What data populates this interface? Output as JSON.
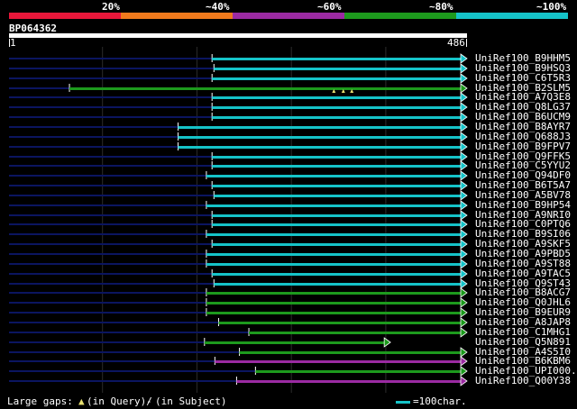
{
  "coverage_scale": {
    "ticks": [
      "20%",
      "~40%",
      "~60%",
      "~80%",
      "~100%"
    ],
    "segments": [
      {
        "color": "#e8173a"
      },
      {
        "color": "#f07a1c"
      },
      {
        "color": "#9b2aa2"
      },
      {
        "color": "#1d9a1d"
      },
      {
        "color": "#15c3c8"
      }
    ]
  },
  "query": {
    "name": "BP064362",
    "start_label": "1",
    "end_label": "486",
    "length": 486
  },
  "colors": {
    "cyan": "#15c3c8",
    "green": "#1d9a1d",
    "purple": "#9b2aa2",
    "navy": "#0b1560",
    "gap": "#e8e070",
    "grid": "#2c2c2c"
  },
  "hits": [
    {
      "label": "UniRef100_B9HHM5",
      "start": 216,
      "end": 486,
      "color": "cyan",
      "full": true
    },
    {
      "label": "UniRef100_B9HSQ3",
      "start": 218,
      "end": 486,
      "color": "cyan",
      "full": true
    },
    {
      "label": "UniRef100_C6T5R3",
      "start": 216,
      "end": 486,
      "color": "cyan",
      "full": true
    },
    {
      "label": "UniRef100_B2SLM5",
      "start": 65,
      "end": 486,
      "color": "green",
      "full": true,
      "gaps": [
        345,
        355,
        364
      ]
    },
    {
      "label": "UniRef100_A7Q3E8",
      "start": 216,
      "end": 486,
      "color": "cyan",
      "full": true
    },
    {
      "label": "UniRef100_Q8LG37",
      "start": 216,
      "end": 486,
      "color": "cyan",
      "full": true
    },
    {
      "label": "UniRef100_B6UCM9",
      "start": 216,
      "end": 486,
      "color": "cyan",
      "full": true
    },
    {
      "label": "UniRef100_B8AYR7",
      "start": 180,
      "end": 486,
      "color": "cyan",
      "full": true
    },
    {
      "label": "UniRef100_Q688J3",
      "start": 180,
      "end": 486,
      "color": "cyan",
      "full": true
    },
    {
      "label": "UniRef100_B9FPV7",
      "start": 180,
      "end": 486,
      "color": "cyan",
      "full": true
    },
    {
      "label": "UniRef100_Q9FFK5",
      "start": 216,
      "end": 486,
      "color": "cyan",
      "full": true
    },
    {
      "label": "UniRef100_C5YYU2",
      "start": 216,
      "end": 486,
      "color": "cyan",
      "full": true
    },
    {
      "label": "UniRef100_Q94DF0",
      "start": 210,
      "end": 486,
      "color": "cyan",
      "full": true
    },
    {
      "label": "UniRef100_B6T5A7",
      "start": 216,
      "end": 486,
      "color": "cyan",
      "full": true
    },
    {
      "label": "UniRef100_A5BV78",
      "start": 218,
      "end": 486,
      "color": "cyan",
      "full": true
    },
    {
      "label": "UniRef100_B9HP54",
      "start": 210,
      "end": 486,
      "color": "cyan",
      "full": true
    },
    {
      "label": "UniRef100_A9NRI0",
      "start": 216,
      "end": 486,
      "color": "cyan",
      "full": true
    },
    {
      "label": "UniRef100_C0PTQ6",
      "start": 216,
      "end": 486,
      "color": "cyan",
      "full": true
    },
    {
      "label": "UniRef100_B9SI06",
      "start": 210,
      "end": 486,
      "color": "cyan",
      "full": true
    },
    {
      "label": "UniRef100_A9SKF5",
      "start": 216,
      "end": 486,
      "color": "cyan",
      "full": true
    },
    {
      "label": "UniRef100_A9PBD5",
      "start": 210,
      "end": 486,
      "color": "cyan",
      "full": true
    },
    {
      "label": "UniRef100_A9ST88",
      "start": 210,
      "end": 486,
      "color": "cyan",
      "full": true
    },
    {
      "label": "UniRef100_A9TAC5",
      "start": 216,
      "end": 486,
      "color": "cyan",
      "full": true
    },
    {
      "label": "UniRef100_Q9ST43",
      "start": 218,
      "end": 486,
      "color": "cyan",
      "full": true
    },
    {
      "label": "UniRef100_B8ACG7",
      "start": 210,
      "end": 486,
      "color": "green",
      "full": true
    },
    {
      "label": "UniRef100_Q0JHL6",
      "start": 210,
      "end": 486,
      "color": "green",
      "full": true
    },
    {
      "label": "UniRef100_B9EUR9",
      "start": 210,
      "end": 486,
      "color": "green",
      "full": true
    },
    {
      "label": "UniRef100_A8JAP8",
      "start": 223,
      "end": 486,
      "color": "green",
      "full": true
    },
    {
      "label": "UniRef100_C1MHG1",
      "start": 255,
      "end": 486,
      "color": "green",
      "full": true
    },
    {
      "label": "UniRef100_Q5N891",
      "start": 208,
      "end": 405,
      "color": "green",
      "full": false
    },
    {
      "label": "UniRef100_A4S5I0",
      "start": 245,
      "end": 486,
      "color": "green",
      "full": true
    },
    {
      "label": "UniRef100_B6KBM6",
      "start": 219,
      "end": 486,
      "color": "purple",
      "full": true
    },
    {
      "label": "UniRef100_UPI000..",
      "start": 262,
      "end": 486,
      "color": "green",
      "full": true
    },
    {
      "label": "UniRef100_Q00Y38",
      "start": 242,
      "end": 486,
      "color": "purple",
      "full": false
    }
  ],
  "footer": {
    "gaps_text": "Large gaps:",
    "gaps_query": "(in Query)/",
    "gaps_dash": "-",
    "gaps_subject": "(in Subject)",
    "scale_text": "=100char."
  }
}
